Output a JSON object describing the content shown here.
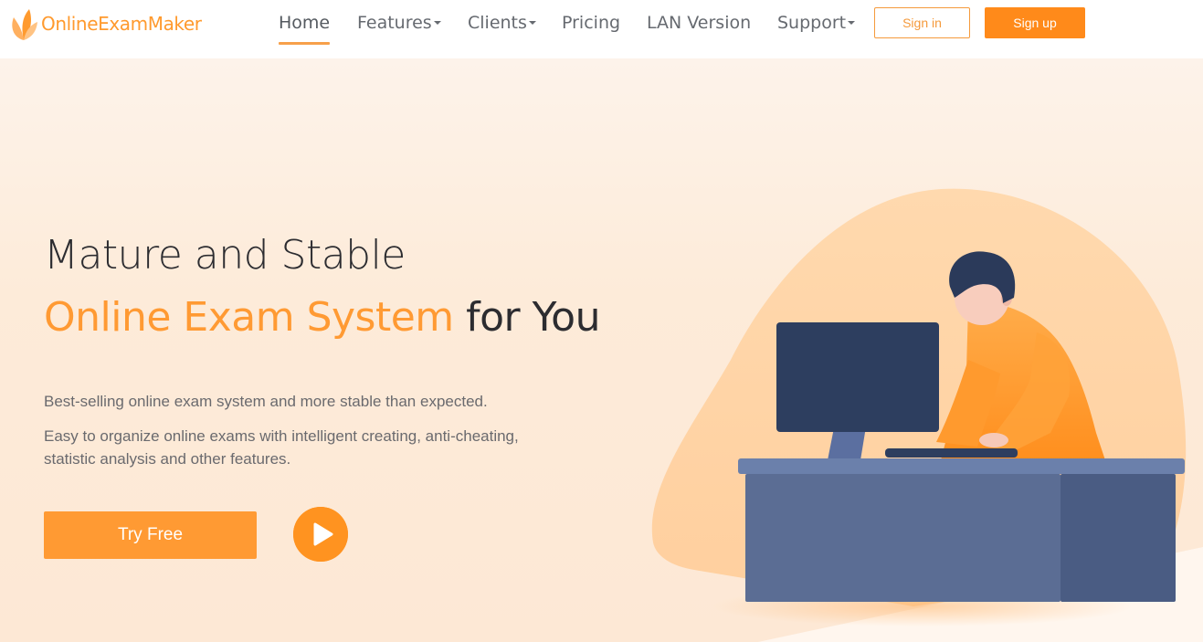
{
  "brand": {
    "name": "OnlineExamMaker",
    "accent_color": "#ff9a33"
  },
  "nav": {
    "items": [
      {
        "label": "Home",
        "active": true,
        "dropdown": false
      },
      {
        "label": "Features",
        "active": false,
        "dropdown": true
      },
      {
        "label": "Clients",
        "active": false,
        "dropdown": true
      },
      {
        "label": "Pricing",
        "active": false,
        "dropdown": false
      },
      {
        "label": "LAN Version",
        "active": false,
        "dropdown": false
      },
      {
        "label": "Support",
        "active": false,
        "dropdown": true
      }
    ],
    "signin_label": "Sign in",
    "signup_label": "Sign up"
  },
  "hero": {
    "headline_line1": "Mature and Stable",
    "headline_accent": "Online Exam System",
    "headline_rest": " for You",
    "description1": "Best-selling online exam system and more stable than expected.",
    "description2": "Easy to organize online exams with intelligent creating, anti-cheating, statistic analysis and other features.",
    "try_free_label": "Try Free",
    "play_icon": "play-icon",
    "illustration": "person-at-computer-illustration"
  }
}
